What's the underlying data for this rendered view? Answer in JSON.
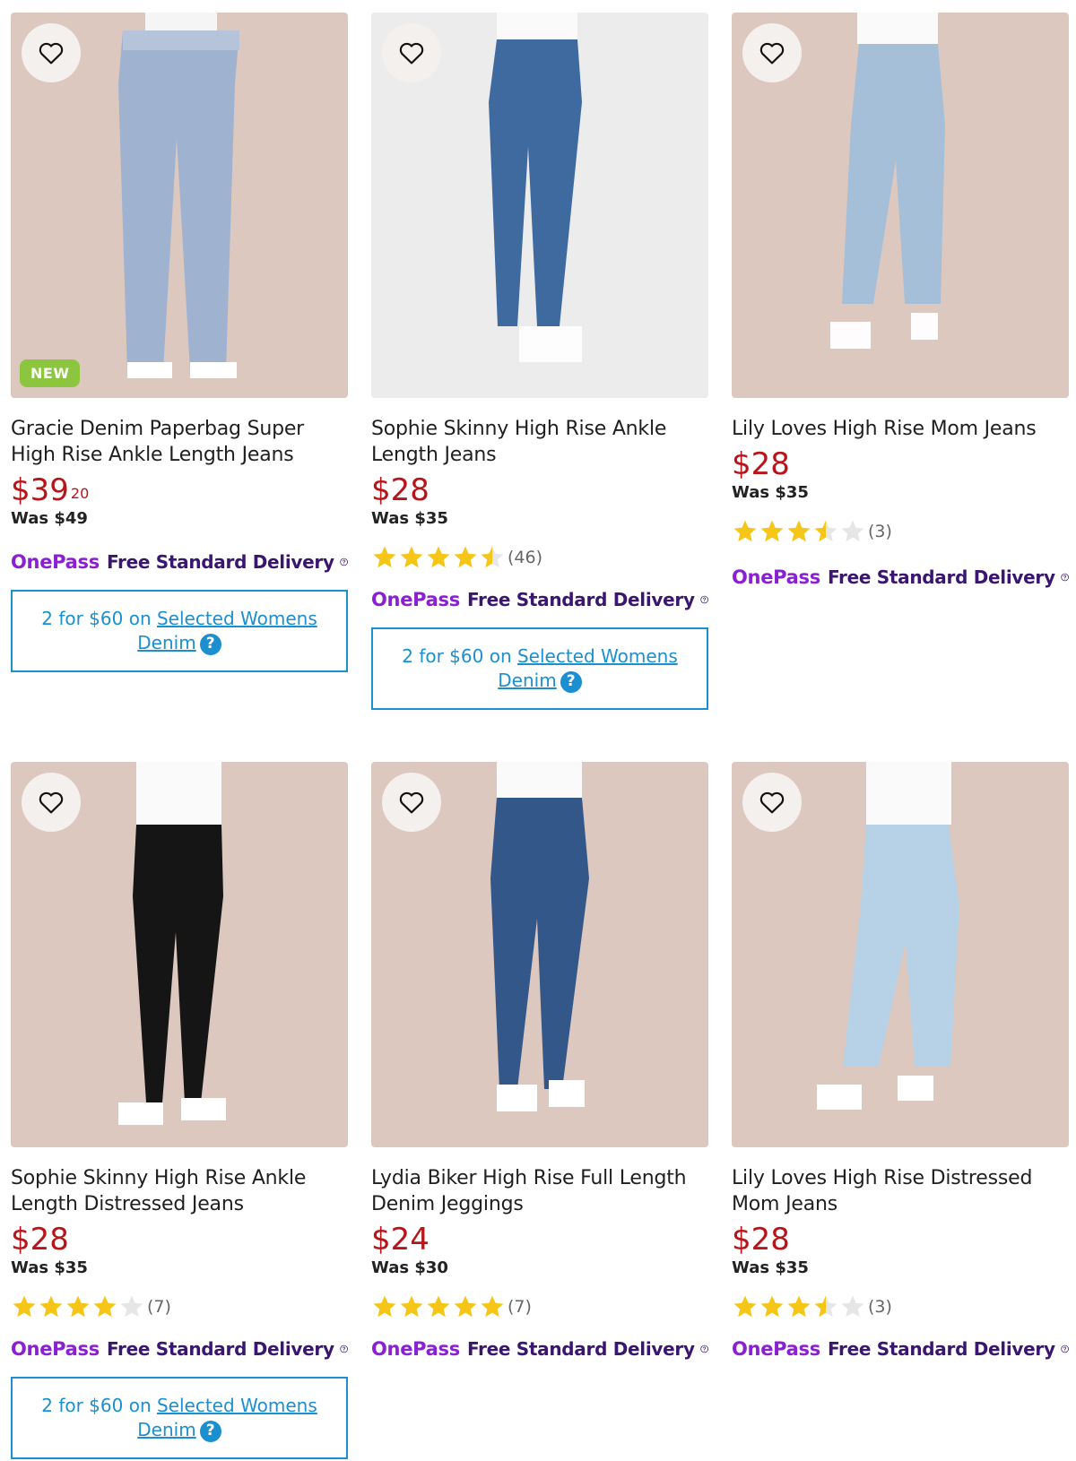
{
  "onepass_logo": "OnePass",
  "onepass_text": "Free Standard Delivery",
  "promo": {
    "prefix": "2 for $60 on ",
    "link_part1": "Selected Womens",
    "link_part2": "Denim"
  },
  "products": [
    {
      "title": "Gracie Denim Paperbag Super High Rise Ankle Length Jeans",
      "price_main": "$39",
      "price_cents": "20",
      "was": "Was $49",
      "badge": "NEW",
      "rating": null,
      "review_count": "",
      "has_promo": true
    },
    {
      "title": "Sophie Skinny High Rise Ankle Length Jeans",
      "price_main": "$28",
      "price_cents": "",
      "was": "Was $35",
      "badge": "",
      "rating": 4.5,
      "review_count": "(46)",
      "has_promo": true
    },
    {
      "title": "Lily Loves High Rise Mom Jeans",
      "price_main": "$28",
      "price_cents": "",
      "was": "Was $35",
      "badge": "",
      "rating": 3.5,
      "review_count": "(3)",
      "has_promo": false
    },
    {
      "title": "Sophie Skinny High Rise Ankle Length Distressed Jeans",
      "price_main": "$28",
      "price_cents": "",
      "was": "Was $35",
      "badge": "",
      "rating": 4,
      "review_count": "(7)",
      "has_promo": true
    },
    {
      "title": "Lydia Biker High Rise Full Length Denim Jeggings",
      "price_main": "$24",
      "price_cents": "",
      "was": "Was $30",
      "badge": "",
      "rating": 5,
      "review_count": "(7)",
      "has_promo": false
    },
    {
      "title": "Lily Loves High Rise Distressed Mom Jeans",
      "price_main": "$28",
      "price_cents": "",
      "was": "Was $35",
      "badge": "",
      "rating": 3.5,
      "review_count": "(3)",
      "has_promo": false
    }
  ],
  "colors": {
    "price_red": "#b8141a",
    "onepass_purple": "#8a1fd3",
    "onepass_text": "#3a1670",
    "promo_blue": "#1c8fd0",
    "star_gold": "#f5c518",
    "star_empty": "#e6e6e6",
    "badge_green": "#8cc63f",
    "photo_bg_beige": "#dcc8bf",
    "photo_bg_grey": "#ececec"
  },
  "icons": {
    "wishlist": "heart-outline-icon",
    "help": "question-circle-icon",
    "star": "star-icon"
  }
}
